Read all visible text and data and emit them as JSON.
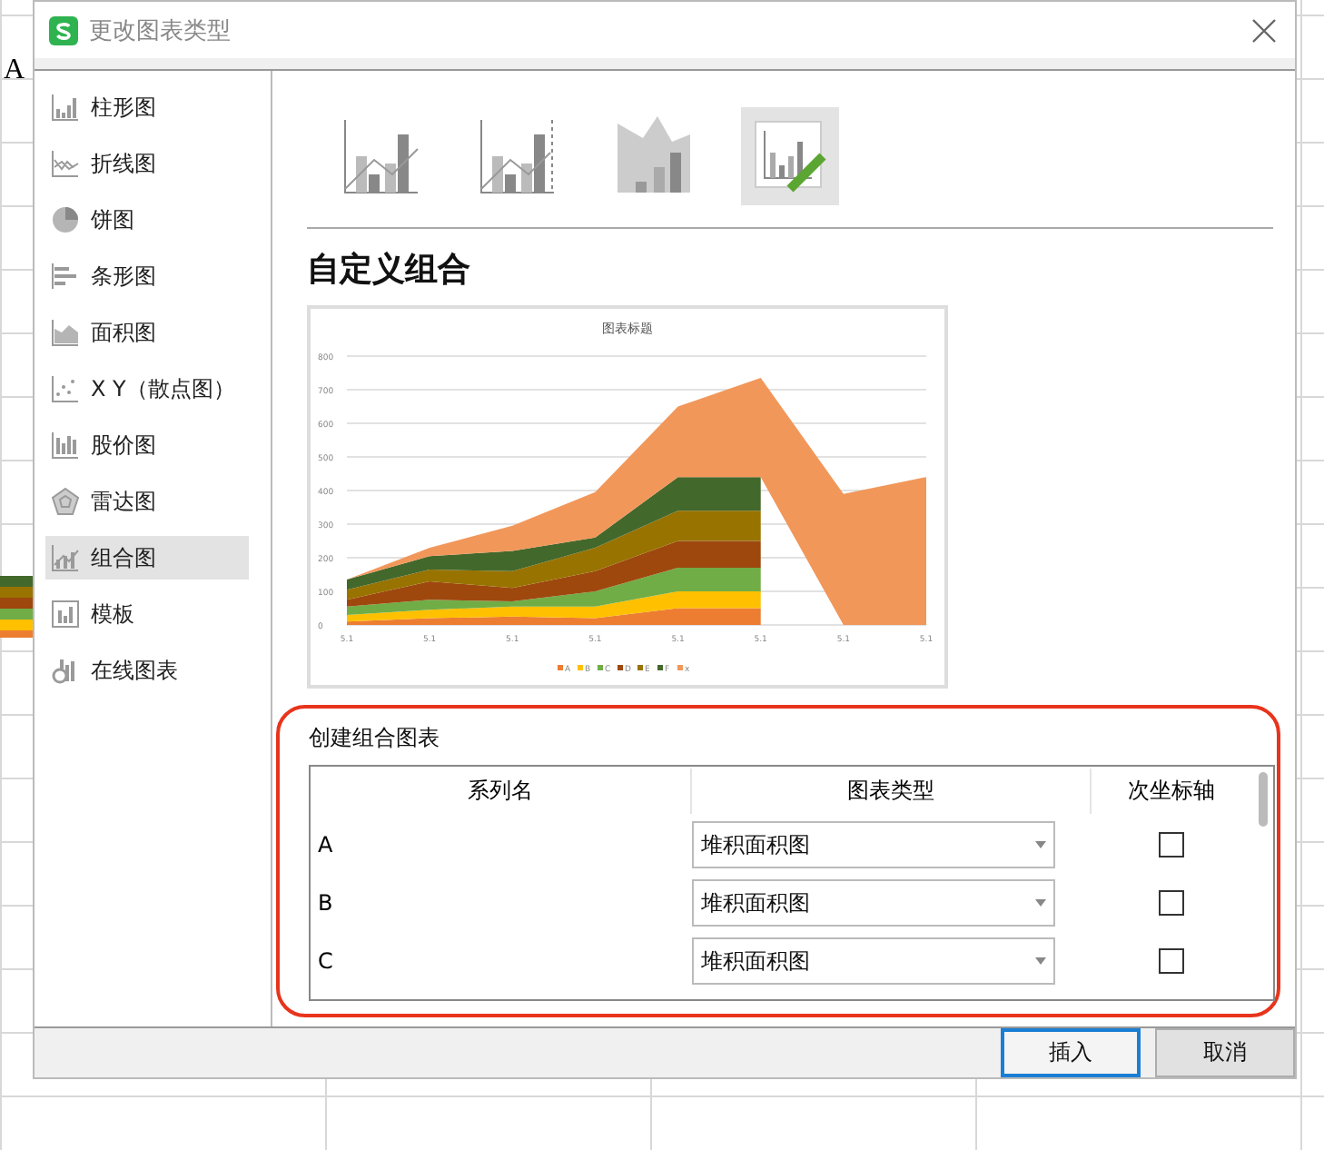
{
  "sheet_cell": "A",
  "window": {
    "title": "更改图表类型"
  },
  "sidebar": {
    "items": [
      {
        "kind": "column",
        "label": "柱形图",
        "selected": false
      },
      {
        "kind": "line",
        "label": "折线图",
        "selected": false
      },
      {
        "kind": "pie",
        "label": "饼图",
        "selected": false
      },
      {
        "kind": "bar",
        "label": "条形图",
        "selected": false
      },
      {
        "kind": "area",
        "label": "面积图",
        "selected": false
      },
      {
        "kind": "scatter",
        "label": "X Y（散点图）",
        "selected": false
      },
      {
        "kind": "stock",
        "label": "股价图",
        "selected": false
      },
      {
        "kind": "radar",
        "label": "雷达图",
        "selected": false
      },
      {
        "kind": "combo",
        "label": "组合图",
        "selected": true
      },
      {
        "kind": "template",
        "label": "模板",
        "selected": false
      },
      {
        "kind": "online",
        "label": "在线图表",
        "selected": false
      }
    ]
  },
  "subtypes": [
    {
      "kind": "column-line",
      "selected": false
    },
    {
      "kind": "column-line-secondary",
      "selected": false
    },
    {
      "kind": "area-column",
      "selected": false
    },
    {
      "kind": "custom",
      "selected": true
    }
  ],
  "heading": "自定义组合",
  "preview": {
    "chart_data": {
      "type": "area",
      "title": "图表标题",
      "stacked": true,
      "categories": [
        "5.1",
        "5.1",
        "5.1",
        "5.1",
        "5.1",
        "5.1",
        "5.1",
        "5.1"
      ],
      "yticks": [
        0,
        100,
        200,
        300,
        400,
        500,
        600,
        700,
        800
      ],
      "ylim": [
        0,
        800
      ],
      "grid": true,
      "legend": true,
      "series": [
        {
          "name": "A",
          "color": "#ed7d31",
          "values": [
            10,
            20,
            25,
            20,
            50,
            50,
            null,
            null
          ]
        },
        {
          "name": "B",
          "color": "#ffc000",
          "values": [
            20,
            25,
            30,
            35,
            50,
            50,
            null,
            null
          ]
        },
        {
          "name": "C",
          "color": "#70ad47",
          "values": [
            25,
            30,
            15,
            45,
            70,
            70,
            null,
            null
          ]
        },
        {
          "name": "D",
          "color": "#9e480e",
          "values": [
            20,
            55,
            40,
            60,
            80,
            80,
            null,
            null
          ]
        },
        {
          "name": "E",
          "color": "#997300",
          "values": [
            30,
            35,
            50,
            70,
            90,
            90,
            null,
            null
          ]
        },
        {
          "name": "F",
          "color": "#43682b",
          "values": [
            30,
            40,
            60,
            30,
            100,
            100,
            null,
            null
          ]
        },
        {
          "name": "x",
          "color": "#f1975a",
          "values": [
            0,
            25,
            75,
            135,
            210,
            295,
            390,
            440
          ]
        }
      ]
    }
  },
  "combo": {
    "title": "创建组合图表",
    "columns": [
      "系列名",
      "图表类型",
      "次坐标轴"
    ],
    "rows": [
      {
        "name": "A",
        "type": "堆积面积图",
        "secondary_axis": false
      },
      {
        "name": "B",
        "type": "堆积面积图",
        "secondary_axis": false
      },
      {
        "name": "C",
        "type": "堆积面积图",
        "secondary_axis": false
      }
    ]
  },
  "buttons": [
    {
      "label": "插入",
      "kind": "primary"
    },
    {
      "label": "取消",
      "kind": "normal"
    }
  ]
}
